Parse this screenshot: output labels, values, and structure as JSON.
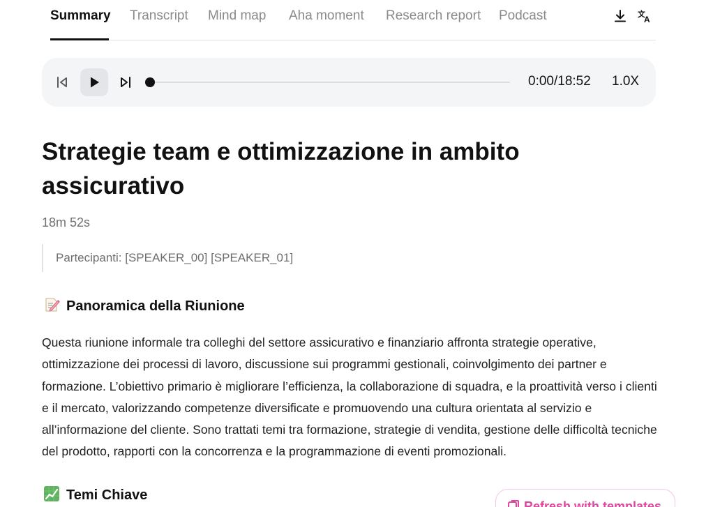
{
  "tabs": [
    {
      "label": "Summary",
      "active": true
    },
    {
      "label": "Transcript",
      "active": false
    },
    {
      "label": "Mind map",
      "active": false
    },
    {
      "label": "Aha moment",
      "active": false
    },
    {
      "label": "Research report",
      "active": false
    },
    {
      "label": "Podcast",
      "active": false
    }
  ],
  "toolbar_icons": [
    "download-icon",
    "translate-icon"
  ],
  "player": {
    "time": "0:00/18:52",
    "speed": "1.0X",
    "progress": 0,
    "icons": [
      "skip-back-icon",
      "play-icon",
      "skip-forward-icon"
    ]
  },
  "summary": {
    "title": "Strategie team e ottimizzazione in ambito assicurativo",
    "duration": "18m 52s",
    "participants": "Partecipanti: [SPEAKER_00] [SPEAKER_01]",
    "overview": {
      "emoji": "memo-icon",
      "heading": "Panoramica della Riunione",
      "text": "Questa riunione informale tra colleghi del settore assicurativo e finanziario affronta strategie operative, ottimizzazione dei processi di lavoro, discussione sui programmi gestionali, coinvolgimento dei partner e formazione. L’obiettivo primario è migliorare l’efficienza, la collaborazione di squadra, e la proattività verso i clienti e il mercato, valorizzando competenze diversificate e promuovendo una cultura orientata al servizio e all’informazione del cliente. Sono trattati temi tra formazione, strategie di vendita, gestione delle difficoltà tecniche del prodotto, rapporti con la concorrenza e la programmazione di eventi promozionali."
    },
    "themes": {
      "emoji": "chart-increasing-icon",
      "heading": "Temi Chiave"
    }
  },
  "refresh_button": {
    "label": "Refresh with templates",
    "icon": "template-icon"
  },
  "colors": {
    "accent_pink": "#e0469f",
    "player_bg": "#f4f5f7",
    "divider": "#e3e3e3"
  }
}
